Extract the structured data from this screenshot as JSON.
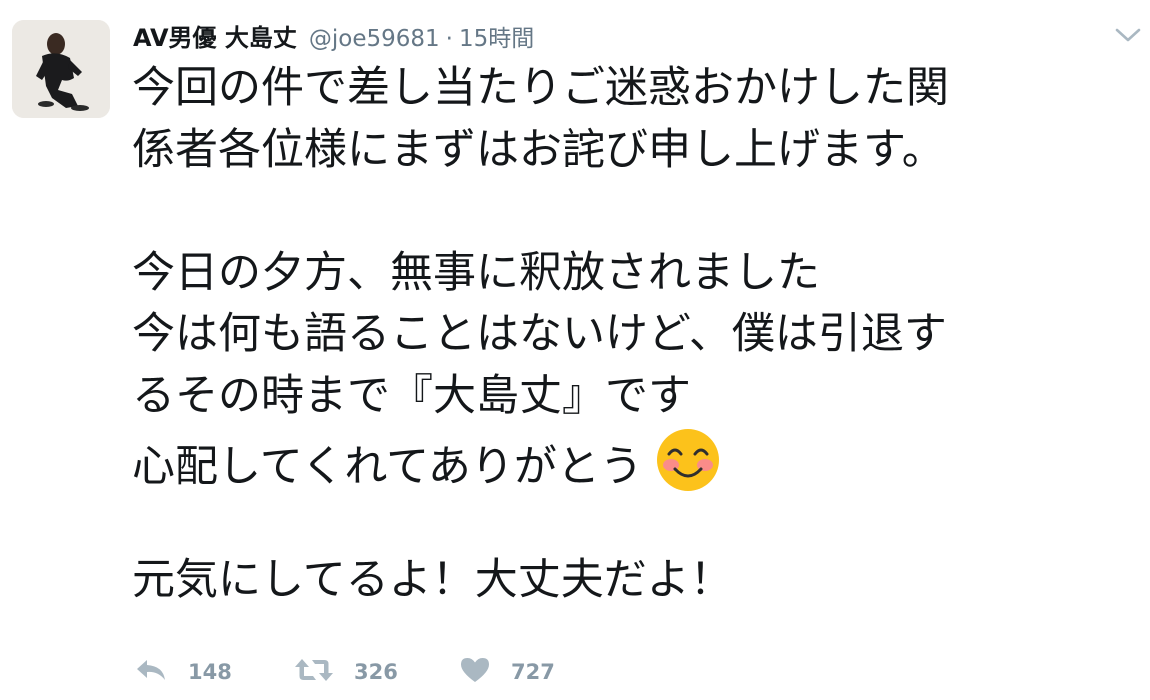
{
  "tweet": {
    "display_name": "AV男優 大島丈",
    "handle": "@joe59681",
    "separator": "·",
    "timestamp": "15時間",
    "lines": [
      "今回の件で差し当たりご迷惑おかけした関",
      "係者各位様にまずはお詫び申し上げます。",
      "",
      "今日の夕方、無事に釈放されました",
      "今は何も語ることはないけど、僕は引退す",
      "るその時まで『大島丈』です",
      "心配してくれてありがとう",
      "",
      "元気にしてるよ！大丈夫だよ！"
    ],
    "emoji": "smiling-face-with-smiling-eyes",
    "actions": {
      "reply_count": "148",
      "retweet_count": "326",
      "like_count": "727"
    }
  },
  "colors": {
    "text": "#14171a",
    "secondary": "#657786",
    "action": "#8899a6",
    "emoji_face": "#fcc21b",
    "emoji_blush": "#f9839c"
  }
}
